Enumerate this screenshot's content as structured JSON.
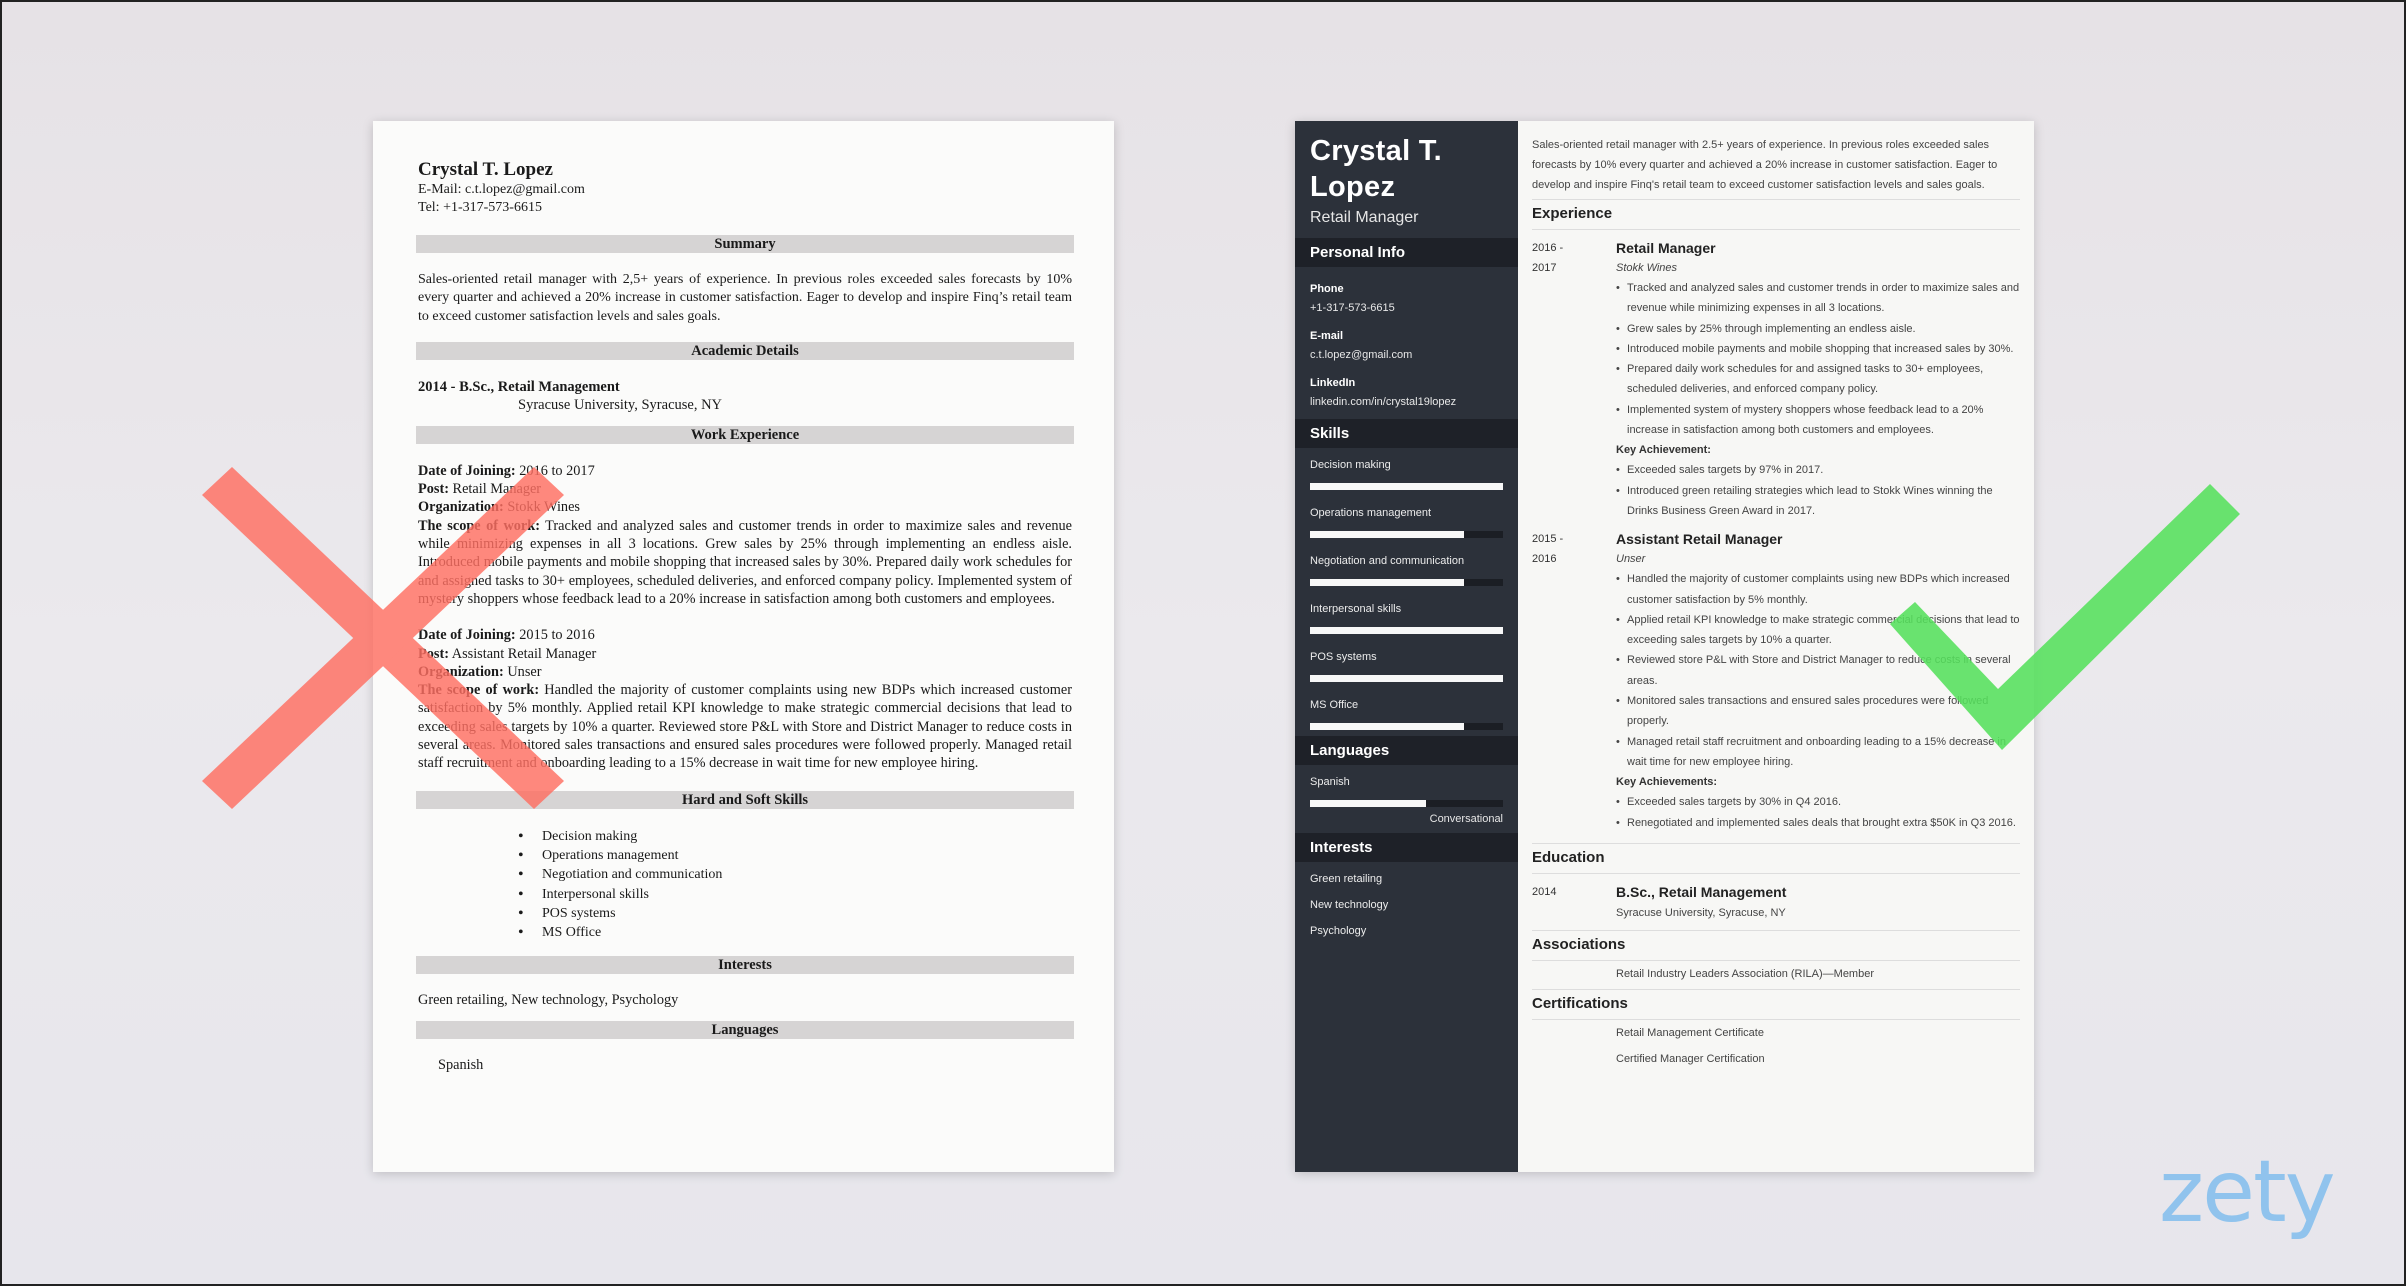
{
  "brand": {
    "logo_text": "zety",
    "logo_color": "#8cc2ee"
  },
  "verdicts": {
    "bad": {
      "icon": "cross-mark",
      "color": "#ff7a6e"
    },
    "good": {
      "icon": "check-mark",
      "color": "#5fe266"
    }
  },
  "bad_resume": {
    "name": "Crystal T. Lopez",
    "email": "E-Mail: c.t.lopez@gmail.com",
    "tel": "Tel: +1-317-573-6615",
    "sections": {
      "summary": "Summary",
      "academic": "Academic Details",
      "work": "Work Experience",
      "skills": "Hard and Soft Skills",
      "interests": "Interests",
      "languages": "Languages"
    },
    "summary_text": "Sales-oriented retail manager with 2,5+ years of experience. In previous roles exceeded sales forecasts by 10% every quarter and achieved a 20% increase in customer satisfaction. Eager to develop and inspire Finq’s retail team to exceed customer satisfaction levels and sales goals.",
    "education": {
      "title": "2014 - B.Sc., Retail Management",
      "school": "Syracuse University, Syracuse, NY"
    },
    "labels": {
      "date": "Date of Joining:",
      "post": "Post:",
      "org": "Organization:",
      "scope": "The scope of work:"
    },
    "jobs": [
      {
        "date": "2016 to 2017",
        "post": "Retail Manager",
        "org": "Stokk Wines",
        "scope": "Tracked and analyzed sales and customer trends in order to maximize sales and revenue while minimizing expenses in all 3 locations. Grew sales by 25% through implementing an endless aisle. Introduced mobile payments and mobile shopping that increased sales by 30%. Prepared daily work schedules for and assigned tasks to 30+ employees, scheduled deliveries, and enforced company policy. Implemented system of mystery shoppers whose feedback lead to a 20% increase in satisfaction among both customers and employees."
      },
      {
        "date": "2015 to 2016",
        "post": "Assistant Retail Manager",
        "org": "Unser",
        "scope": "Handled the majority of customer complaints using new BDPs which increased customer satisfaction by 5% monthly. Applied retail KPI knowledge to make strategic commercial decisions that lead to exceeding sales targets by 10% a quarter. Reviewed store P&L with Store and District Manager to reduce costs in several areas. Monitored sales transactions and ensured sales procedures were followed properly. Managed retail staff recruitment and onboarding leading to a 15% decrease in wait time for new employee hiring."
      }
    ],
    "skills": [
      "Decision making",
      "Operations management",
      "Negotiation and communication",
      "Interpersonal skills",
      "POS systems",
      "MS Office"
    ],
    "interests_text": "Green retailing, New technology, Psychology",
    "language": "Spanish"
  },
  "good_resume": {
    "name_line1": "Crystal T.",
    "name_line2": "Lopez",
    "job_title": "Retail Manager",
    "sidebar": {
      "personal_info_title": "Personal Info",
      "phone_label": "Phone",
      "phone": "+1-317-573-6615",
      "email_label": "E-mail",
      "email": "c.t.lopez@gmail.com",
      "linkedin_label": "LinkedIn",
      "linkedin": "linkedin.com/in/crystal19lopez",
      "skills_title": "Skills",
      "skills": [
        {
          "name": "Decision making",
          "level": 1.0
        },
        {
          "name": "Operations management",
          "level": 0.8
        },
        {
          "name": "Negotiation and communication",
          "level": 0.8
        },
        {
          "name": "Interpersonal skills",
          "level": 1.0
        },
        {
          "name": "POS systems",
          "level": 1.0
        },
        {
          "name": "MS Office",
          "level": 0.8
        }
      ],
      "languages_title": "Languages",
      "languages": [
        {
          "name": "Spanish",
          "level": 0.6,
          "level_label": "Conversational"
        }
      ],
      "interests_title": "Interests",
      "interests": [
        "Green retailing",
        "New technology",
        "Psychology"
      ]
    },
    "summary": "Sales-oriented retail manager with 2.5+ years of experience. In previous roles exceeded sales forecasts by 10% every quarter and achieved a 20% increase in customer satisfaction. Eager to develop and inspire Finq's retail team to exceed customer satisfaction levels and sales goals.",
    "experience_title": "Experience",
    "jobs": [
      {
        "date_start": "2016 -",
        "date_end": "2017",
        "title": "Retail Manager",
        "org": "Stokk Wines",
        "bullets": [
          "Tracked and analyzed sales and customer trends in order to maximize sales and revenue while minimizing expenses in all 3 locations.",
          "Grew sales by 25% through implementing an endless aisle.",
          "Introduced mobile payments and mobile shopping that increased sales by 30%.",
          "Prepared daily work schedules for and assigned tasks to 30+ employees, scheduled deliveries, and enforced company policy.",
          "Implemented system of mystery shoppers whose feedback lead to a 20% increase in satisfaction among both customers and employees."
        ],
        "key_label": "Key Achievement:",
        "achievements": [
          "Exceeded sales targets by 97% in 2017.",
          "Introduced green retailing strategies which lead to Stokk Wines winning the Drinks Business Green Award in 2017."
        ]
      },
      {
        "date_start": "2015 -",
        "date_end": "2016",
        "title": "Assistant Retail Manager",
        "org": "Unser",
        "bullets": [
          "Handled the majority of customer complaints using new BDPs which increased customer satisfaction by 5% monthly.",
          "Applied retail KPI knowledge to make strategic commercial decisions that lead to exceeding sales targets by 10% a quarter.",
          "Reviewed store P&L with Store and District Manager to reduce costs in several areas.",
          "Monitored sales transactions and ensured sales procedures were followed properly.",
          "Managed retail staff recruitment and onboarding leading to a 15% decrease in wait time for new employee hiring."
        ],
        "key_label": "Key Achievements:",
        "achievements": [
          "Exceeded sales targets by 30% in Q4 2016.",
          "Renegotiated and implemented sales deals that brought extra $50K in Q3 2016."
        ]
      }
    ],
    "education_title": "Education",
    "education": {
      "year": "2014",
      "degree": "B.Sc., Retail Management",
      "school": "Syracuse University, Syracuse, NY"
    },
    "associations_title": "Associations",
    "associations": [
      "Retail Industry Leaders Association (RILA)—Member"
    ],
    "certifications_title": "Certifications",
    "certifications": [
      "Retail Management Certificate",
      "Certified Manager Certification"
    ]
  }
}
